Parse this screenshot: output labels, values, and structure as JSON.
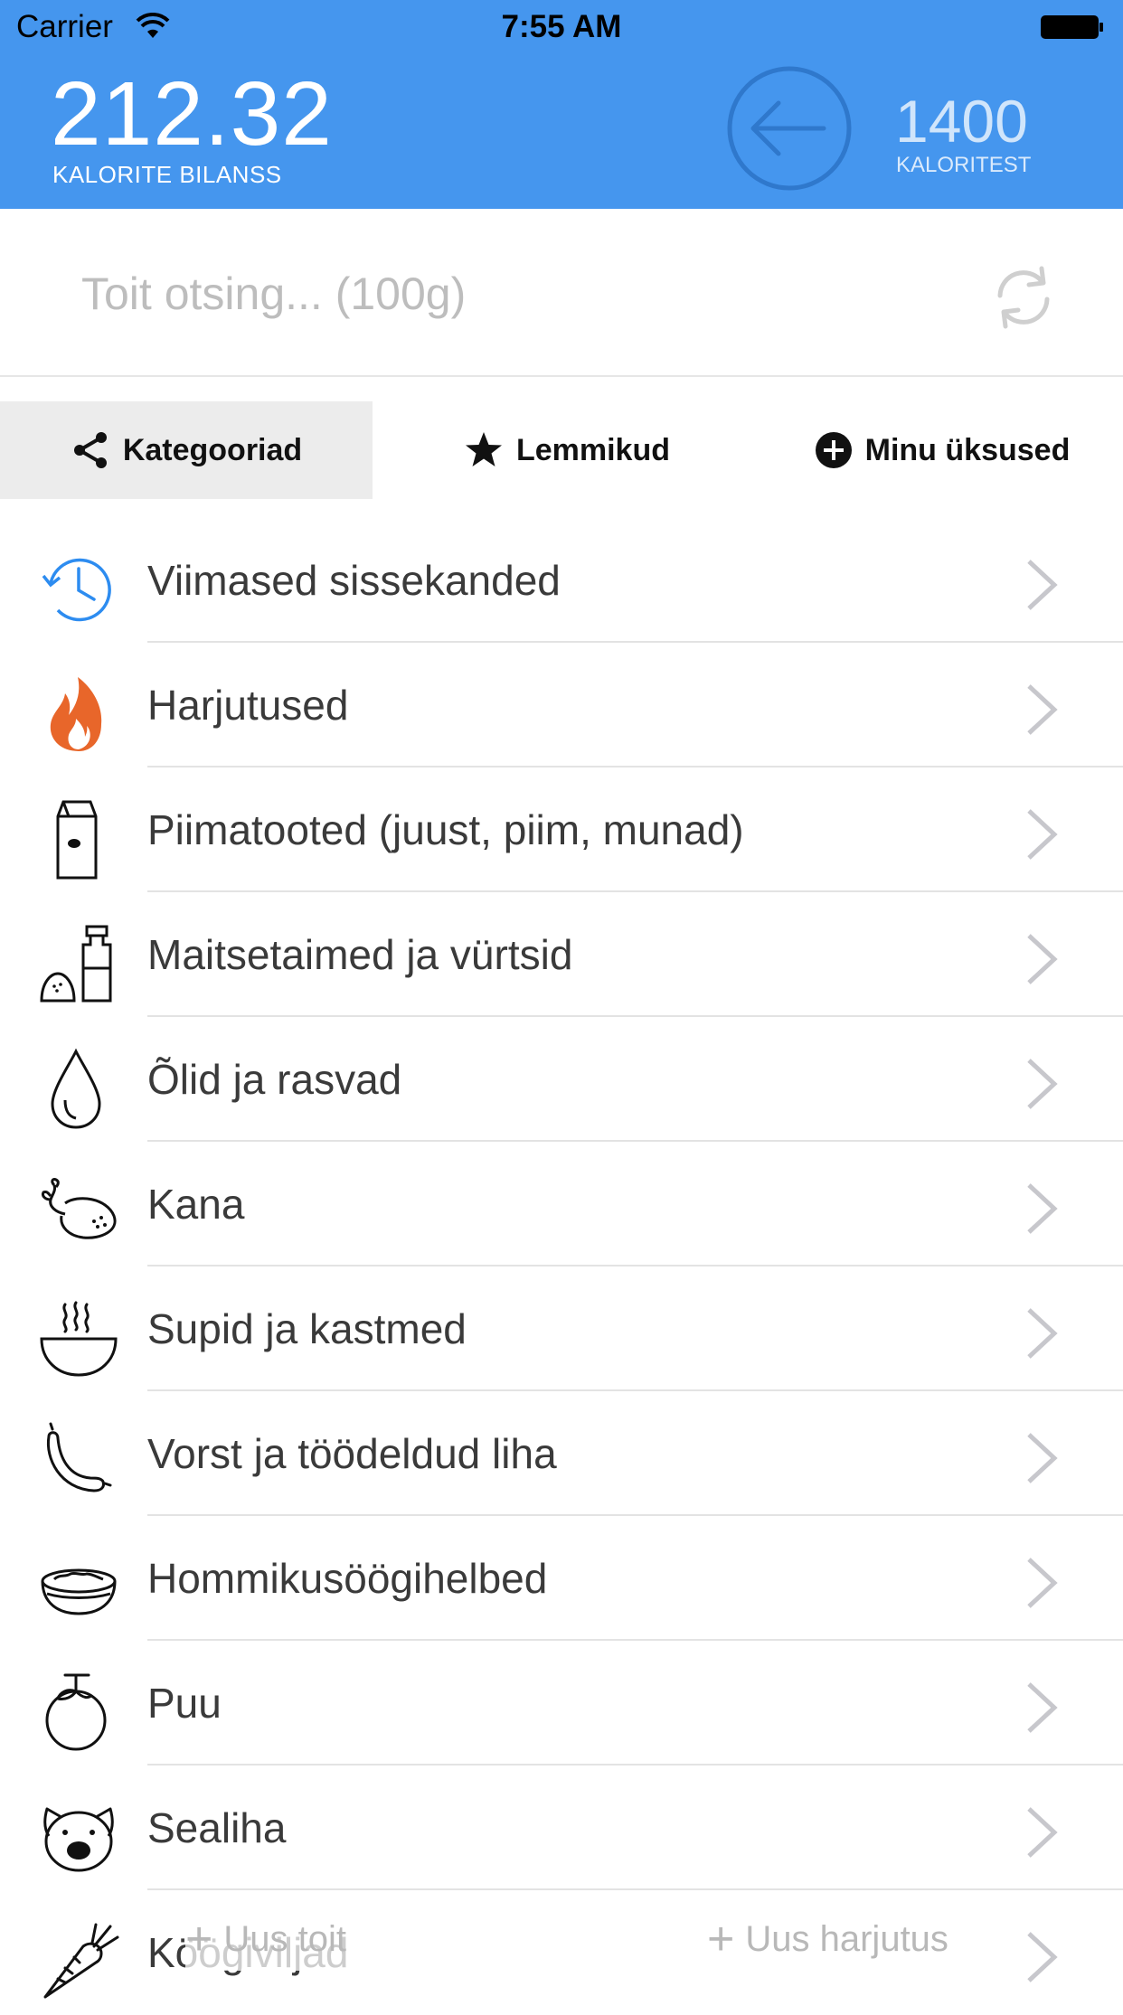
{
  "status_bar": {
    "carrier": "Carrier",
    "time": "7:55 AM"
  },
  "header": {
    "balance_value": "212.32",
    "balance_label": "KALORITE BILANSS",
    "goal_value": "1400",
    "goal_label": "KALORITEST"
  },
  "search": {
    "placeholder": "Toit otsing... (100g)"
  },
  "tabs": [
    {
      "label": "Kategooriad",
      "icon": "share-icon",
      "selected": true
    },
    {
      "label": "Lemmikud",
      "icon": "star-icon",
      "selected": false
    },
    {
      "label": "Minu üksused",
      "icon": "plus-circle-icon",
      "selected": false
    }
  ],
  "categories": [
    {
      "label": "Viimased sissekanded",
      "icon": "clock-history-icon"
    },
    {
      "label": "Harjutused",
      "icon": "flame-icon"
    },
    {
      "label": "Piimatooted (juust, piim, munad)",
      "icon": "milk-carton-icon"
    },
    {
      "label": "Maitsetaimed ja vürtsid",
      "icon": "spice-grinder-icon"
    },
    {
      "label": "Õlid ja rasvad",
      "icon": "oil-drop-icon"
    },
    {
      "label": "Kana",
      "icon": "roast-chicken-icon"
    },
    {
      "label": "Supid ja kastmed",
      "icon": "soup-bowl-icon"
    },
    {
      "label": "Vorst ja töödeldud liha",
      "icon": "sausage-icon"
    },
    {
      "label": "Hommikusöögihelbed",
      "icon": "cereal-bowl-icon"
    },
    {
      "label": "Puu",
      "icon": "fruit-icon"
    },
    {
      "label": "Sealiha",
      "icon": "pig-icon"
    },
    {
      "label": "Köögiviljad",
      "icon": "carrot-icon"
    }
  ],
  "bottom_buttons": {
    "new_food": "Uus toit",
    "new_exercise": "Uus harjutus"
  },
  "colors": {
    "header_blue": "#4596ee",
    "clock_blue": "#2d8cf0",
    "flame_orange": "#e8662a"
  }
}
